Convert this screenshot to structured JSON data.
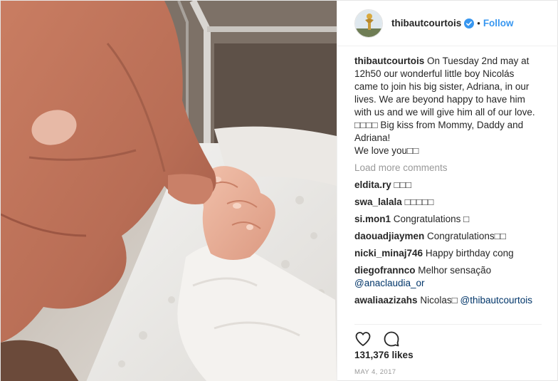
{
  "header": {
    "username": "thibautcourtois",
    "separator": "•",
    "follow_label": "Follow"
  },
  "caption": {
    "username": "thibautcourtois",
    "lines": [
      "On Tuesday 2nd may at",
      "12h50 our wonderful little boy Nicolás",
      "came to join his big sister, Adriana, in our",
      "lives. We are beyond happy to have him",
      "with us and we will give him all of our love.",
      "□□□□ Big kiss from Mommy, Daddy and",
      "Adriana!",
      "We love you□□"
    ]
  },
  "load_more": "Load more comments",
  "comments": [
    {
      "username": "eldita.ry",
      "text": "□□□"
    },
    {
      "username": "swa_lalala",
      "text": "□□□□□"
    },
    {
      "username": "si.mon1",
      "text": "Congratulations □"
    },
    {
      "username": "daouadjiaymen",
      "text": "Congratulations□□"
    },
    {
      "username": "nicki_minaj746",
      "text": "Happy birthday cong"
    },
    {
      "username": "diegofrannco",
      "text": "Melhor sensação",
      "mention": "@anaclaudia_or"
    },
    {
      "username": "awaliaazizahs",
      "text": "Nicolas□",
      "mention": "@thibautcourtois"
    }
  ],
  "likes": "131,376 likes",
  "date": "MAY 4, 2017",
  "colors": {
    "link_blue": "#3897f0",
    "mention_blue": "#003569",
    "muted_gray": "#999999",
    "text": "#262626"
  },
  "icons": {
    "verified": "verified-badge-icon",
    "like": "heart-icon",
    "comment": "comment-bubble-icon"
  }
}
